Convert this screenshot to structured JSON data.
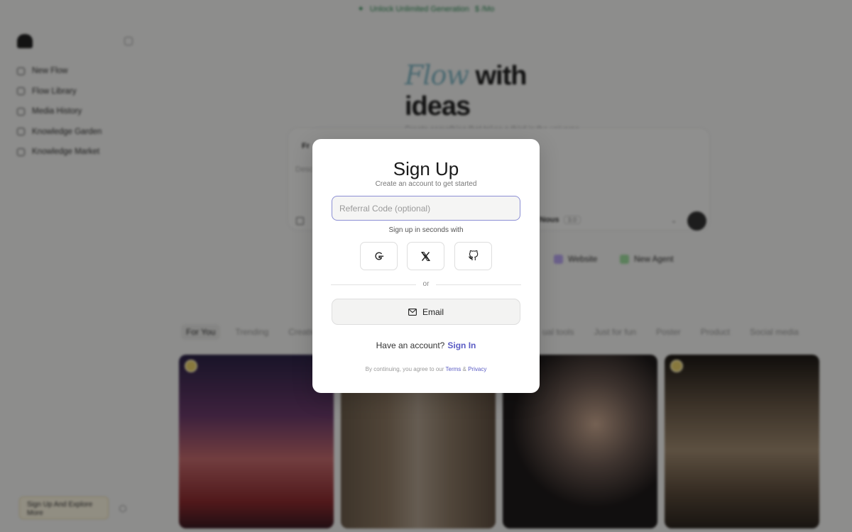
{
  "topbar": {
    "text": "Unlock Unlimited Generation",
    "suffix": "$ /Mo"
  },
  "sidebar": {
    "items": [
      {
        "label": "New Flow"
      },
      {
        "label": "Flow Library"
      },
      {
        "label": "Media History"
      },
      {
        "label": "Knowledge Garden"
      },
      {
        "label": "Knowledge Market"
      }
    ],
    "cta": "Sign Up And Explore More"
  },
  "hero": {
    "script": "Flow",
    "title": "with ideas",
    "subtitle": "Create something that takes a third in the universe"
  },
  "composer": {
    "mode": "Fr",
    "placeholder": "Desc",
    "model": "Nous",
    "model_badge": "3.0"
  },
  "chips": [
    {
      "label": "Website",
      "color": "#b8a6ef"
    },
    {
      "label": "New Agent",
      "color": "#9fdc9f"
    }
  ],
  "tabs": [
    "For You",
    "Trending",
    "Creative",
    "",
    "ual tools",
    "Just for fun",
    "Poster",
    "Product",
    "Social media"
  ],
  "modal": {
    "title": "Sign Up",
    "subtitle": "Create an account to get started",
    "referral_placeholder": "Referral Code (optional)",
    "referral_value": "",
    "sso_label": "Sign up in seconds with",
    "divider": "or",
    "email_label": "Email",
    "have_account": "Have an account?",
    "sign_in": "Sign In",
    "terms_prefix": "By continuing, you agree to our",
    "terms_link": "Terms",
    "amp": "&",
    "privacy_link": "Privacy"
  }
}
